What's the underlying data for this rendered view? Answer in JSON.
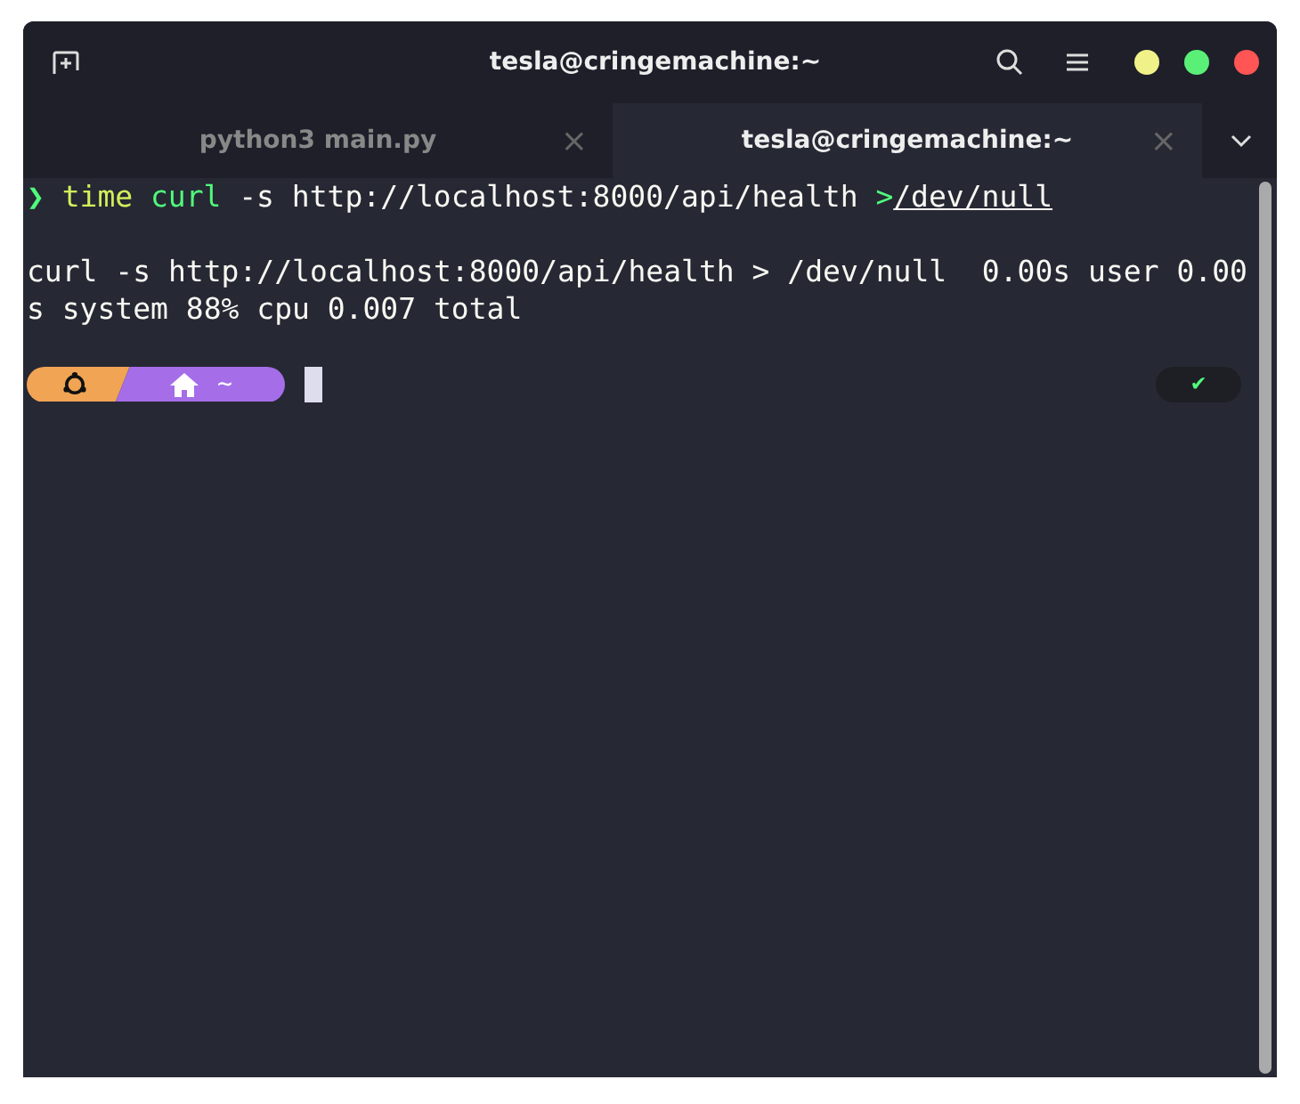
{
  "window": {
    "title": "tesla@cringemachine:~"
  },
  "tabs": [
    {
      "label": "python3 main.py",
      "selected": false,
      "close": "×"
    },
    {
      "label": "tesla@cringemachine:~",
      "selected": true,
      "close": "×"
    }
  ],
  "terminal": {
    "command": [
      {
        "kind": "prompt",
        "text": "❯"
      },
      {
        "kind": "builtin",
        "text": "time"
      },
      {
        "kind": "program",
        "text": "curl"
      },
      {
        "kind": "plain",
        "text": "-s http://localhost:8000/api/health"
      },
      {
        "kind": "operator",
        "text": ">"
      },
      {
        "kind": "path",
        "text": "/dev/null"
      }
    ],
    "output": [
      "curl -s http://localhost:8000/api/health > /dev/null  0.00s user 0.00",
      "s system 88% cpu 0.007 total"
    ],
    "prompt": {
      "dir": "~",
      "status": "✔"
    }
  }
}
